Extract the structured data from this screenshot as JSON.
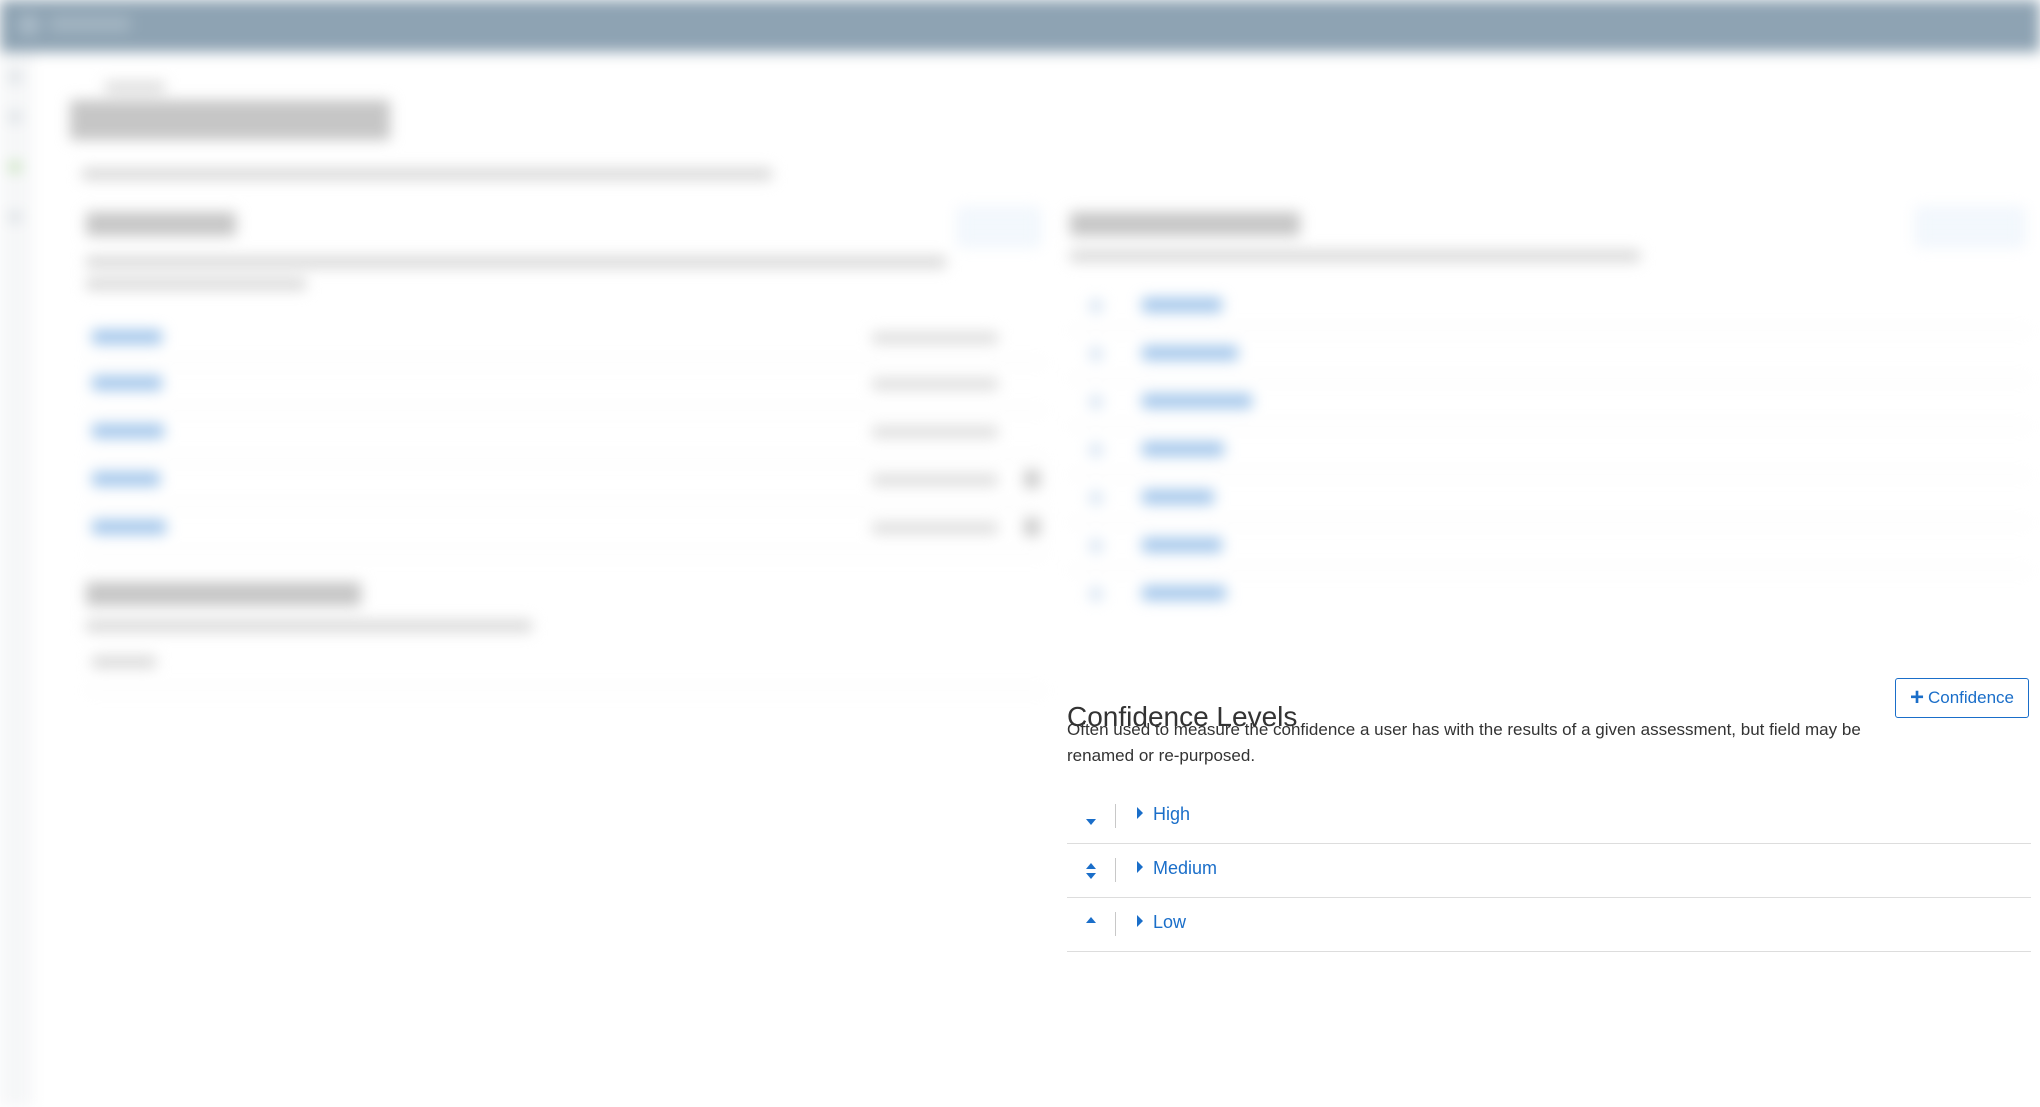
{
  "confidence_panel": {
    "title": "Confidence Levels",
    "description": "Often used to measure the confidence a user has with the results of a given assessment, but field may be renamed or re-purposed.",
    "add_button_label": "Confidence",
    "add_button_icon": "plus-icon",
    "levels": [
      {
        "label": "High",
        "sort_icon": "move-down-icon"
      },
      {
        "label": "Medium",
        "sort_icon": "move-up-down-icon"
      },
      {
        "label": "Low",
        "sort_icon": "move-up-icon"
      }
    ]
  },
  "colors": {
    "accent": "#1a6ec9",
    "topbar": "#8ea3b3"
  }
}
